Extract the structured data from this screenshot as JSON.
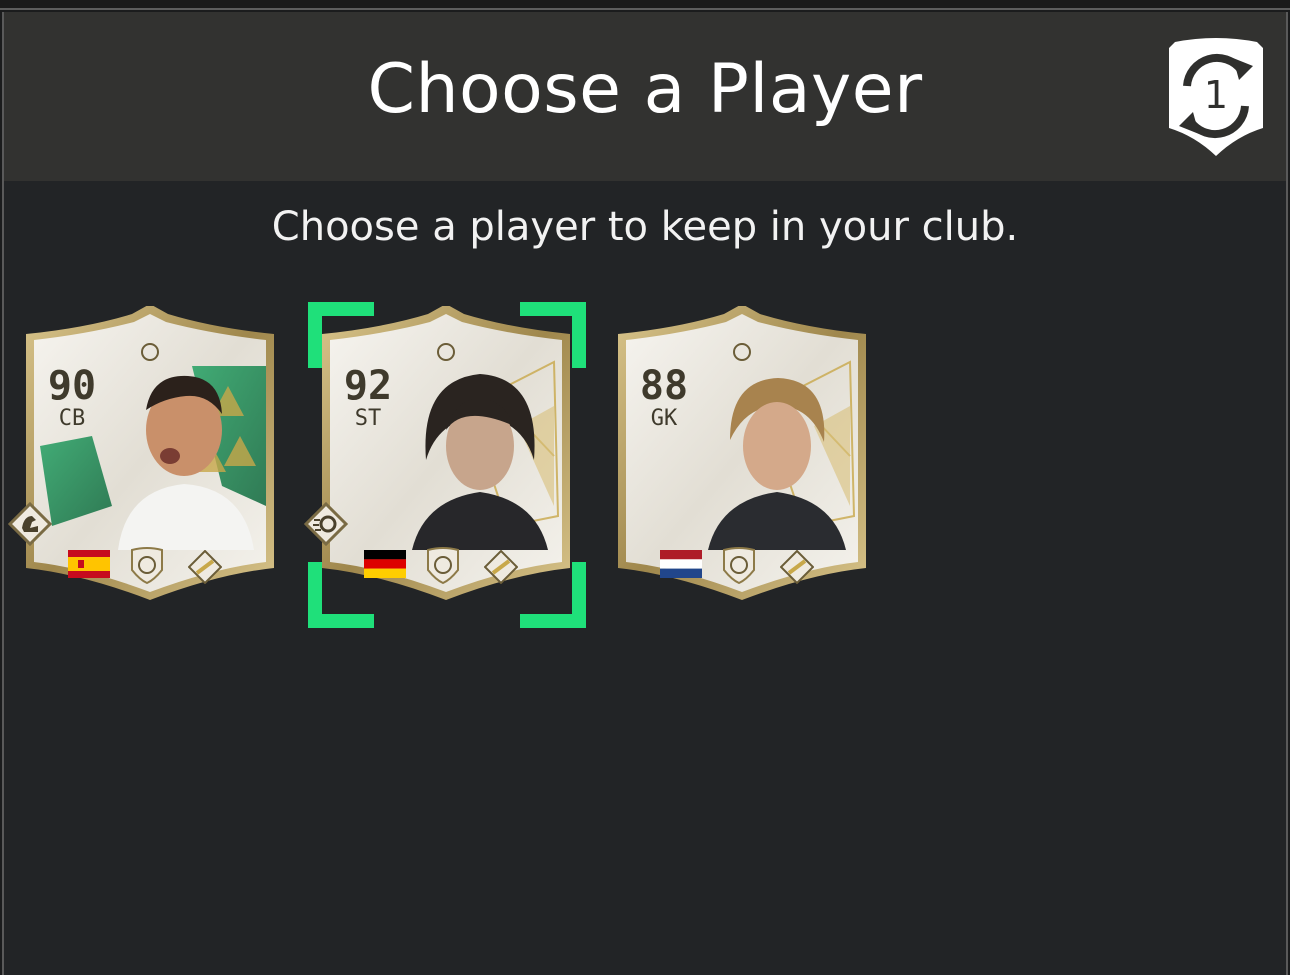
{
  "header": {
    "title": "Choose a Player"
  },
  "subtitle": "Choose a player to keep in your club.",
  "badge": {
    "icon": "swap-count-shield-icon",
    "count": "1"
  },
  "cards": [
    {
      "rating": "90",
      "position": "CB",
      "nation": "Spain",
      "flag_colors": [
        "#c60b1e",
        "#ffc400",
        "#c60b1e"
      ],
      "theme": "green",
      "playstyle_icon": "flexed-arm-icon"
    },
    {
      "rating": "92",
      "position": "ST",
      "nation": "Germany",
      "flag_colors": [
        "#000000",
        "#dd0000",
        "#ffce00"
      ],
      "theme": "gold",
      "playstyle_icon": "power-shot-icon",
      "selected": true
    },
    {
      "rating": "88",
      "position": "GK",
      "nation": "Netherlands",
      "flag_colors": [
        "#ae1c28",
        "#ffffff",
        "#21468b"
      ],
      "theme": "gold"
    }
  ],
  "colors": {
    "selection": "#1fe07a",
    "card_base": "#ece9e2",
    "card_rim": "#b49a5a",
    "text": "#3f3a2c"
  }
}
